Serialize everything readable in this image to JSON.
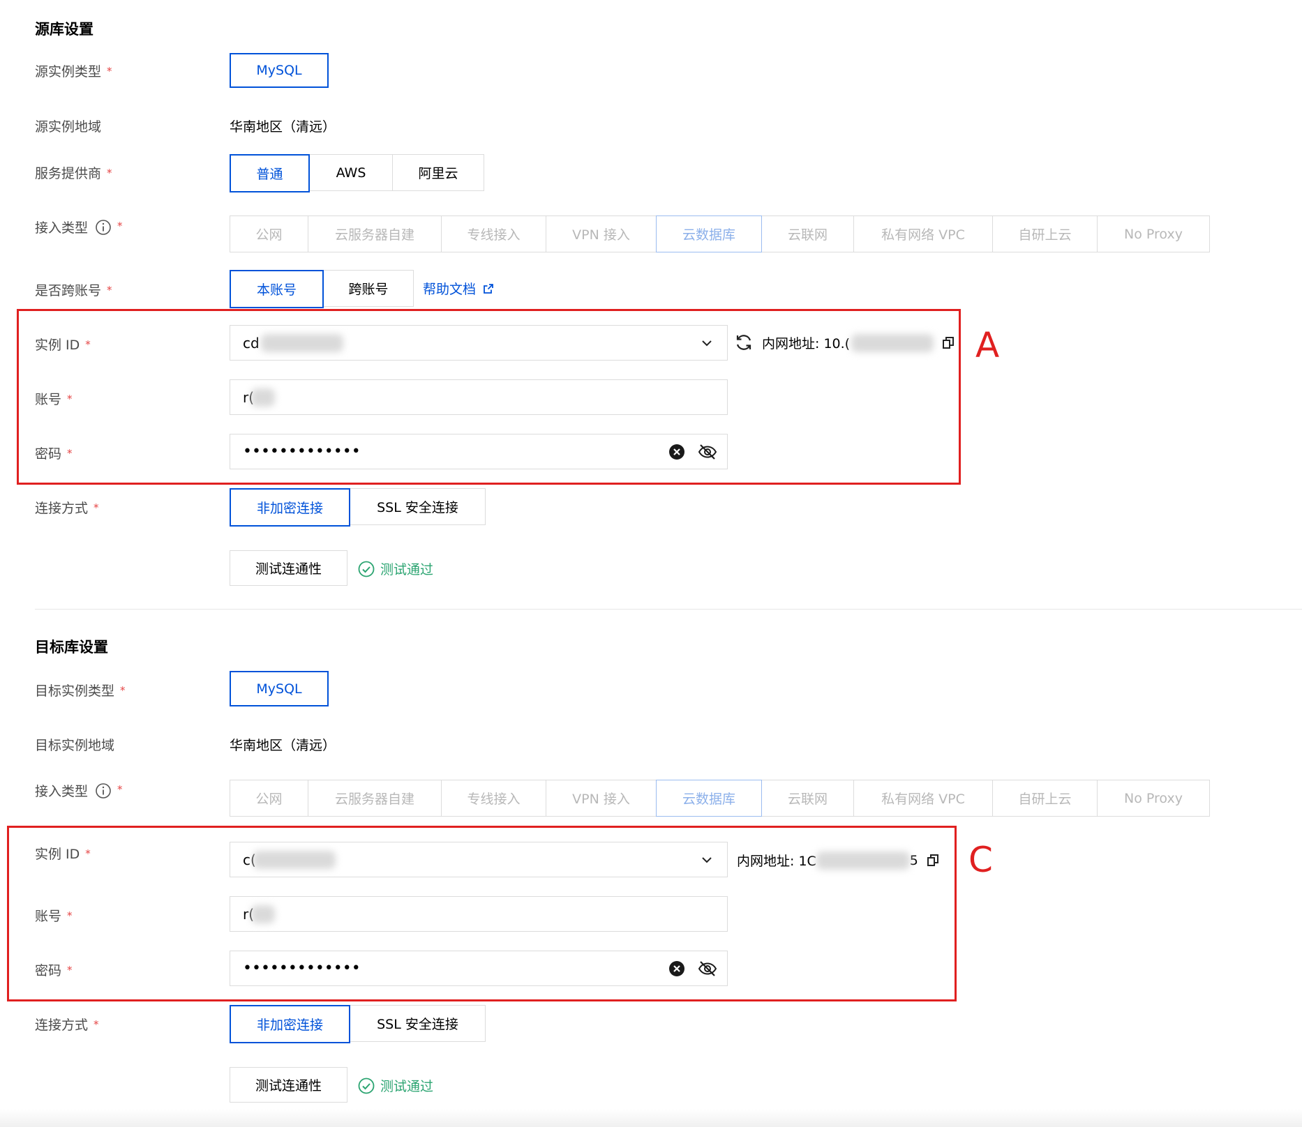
{
  "source": {
    "section_title": "源库设置",
    "instance_type": {
      "label": "源实例类型",
      "value": "MySQL"
    },
    "region": {
      "label": "源实例地域",
      "value": "华南地区（清远）"
    },
    "provider": {
      "label": "服务提供商",
      "options": [
        "普通",
        "AWS",
        "阿里云"
      ],
      "selected": "普通"
    },
    "access_type": {
      "label": "接入类型",
      "options": [
        "公网",
        "云服务器自建",
        "专线接入",
        "VPN 接入",
        "云数据库",
        "云联网",
        "私有网络 VPC",
        "自研上云",
        "No Proxy"
      ],
      "selected": "云数据库"
    },
    "cross_account": {
      "label": "是否跨账号",
      "options": [
        "本账号",
        "跨账号"
      ],
      "selected": "本账号",
      "help_link": "帮助文档"
    },
    "instance_id": {
      "label": "实例 ID",
      "value": "cd",
      "intranet_label": "内网地址: 10.("
    },
    "account": {
      "label": "账号",
      "value": "r("
    },
    "password": {
      "label": "密码",
      "value": "•••••••••••••"
    },
    "connection": {
      "label": "连接方式",
      "options": [
        "非加密连接",
        "SSL 安全连接"
      ],
      "selected": "非加密连接"
    },
    "test": {
      "button": "测试连通性",
      "status": "测试通过"
    }
  },
  "target": {
    "section_title": "目标库设置",
    "instance_type": {
      "label": "目标实例类型",
      "value": "MySQL"
    },
    "region": {
      "label": "目标实例地域",
      "value": "华南地区（清远）"
    },
    "access_type": {
      "label": "接入类型",
      "options": [
        "公网",
        "云服务器自建",
        "专线接入",
        "VPN 接入",
        "云数据库",
        "云联网",
        "私有网络 VPC",
        "自研上云",
        "No Proxy"
      ],
      "selected": "云数据库"
    },
    "instance_id": {
      "label": "实例 ID",
      "value": "c(",
      "intranet_label": "内网地址: 1C",
      "intranet_suffix": "5"
    },
    "account": {
      "label": "账号",
      "value": "r("
    },
    "password": {
      "label": "密码",
      "value": "•••••••••••••"
    },
    "connection": {
      "label": "连接方式",
      "options": [
        "非加密连接",
        "SSL 安全连接"
      ],
      "selected": "非加密连接"
    },
    "test": {
      "button": "测试连通性",
      "status": "测试通过"
    }
  },
  "annotations": {
    "box_a": "A",
    "box_c": "C"
  },
  "required_mark": "*",
  "colors": {
    "primary": "#0052d9",
    "required": "#e54545",
    "success": "#2ba471",
    "annotation": "#e02020",
    "border": "#dcdcdc"
  }
}
